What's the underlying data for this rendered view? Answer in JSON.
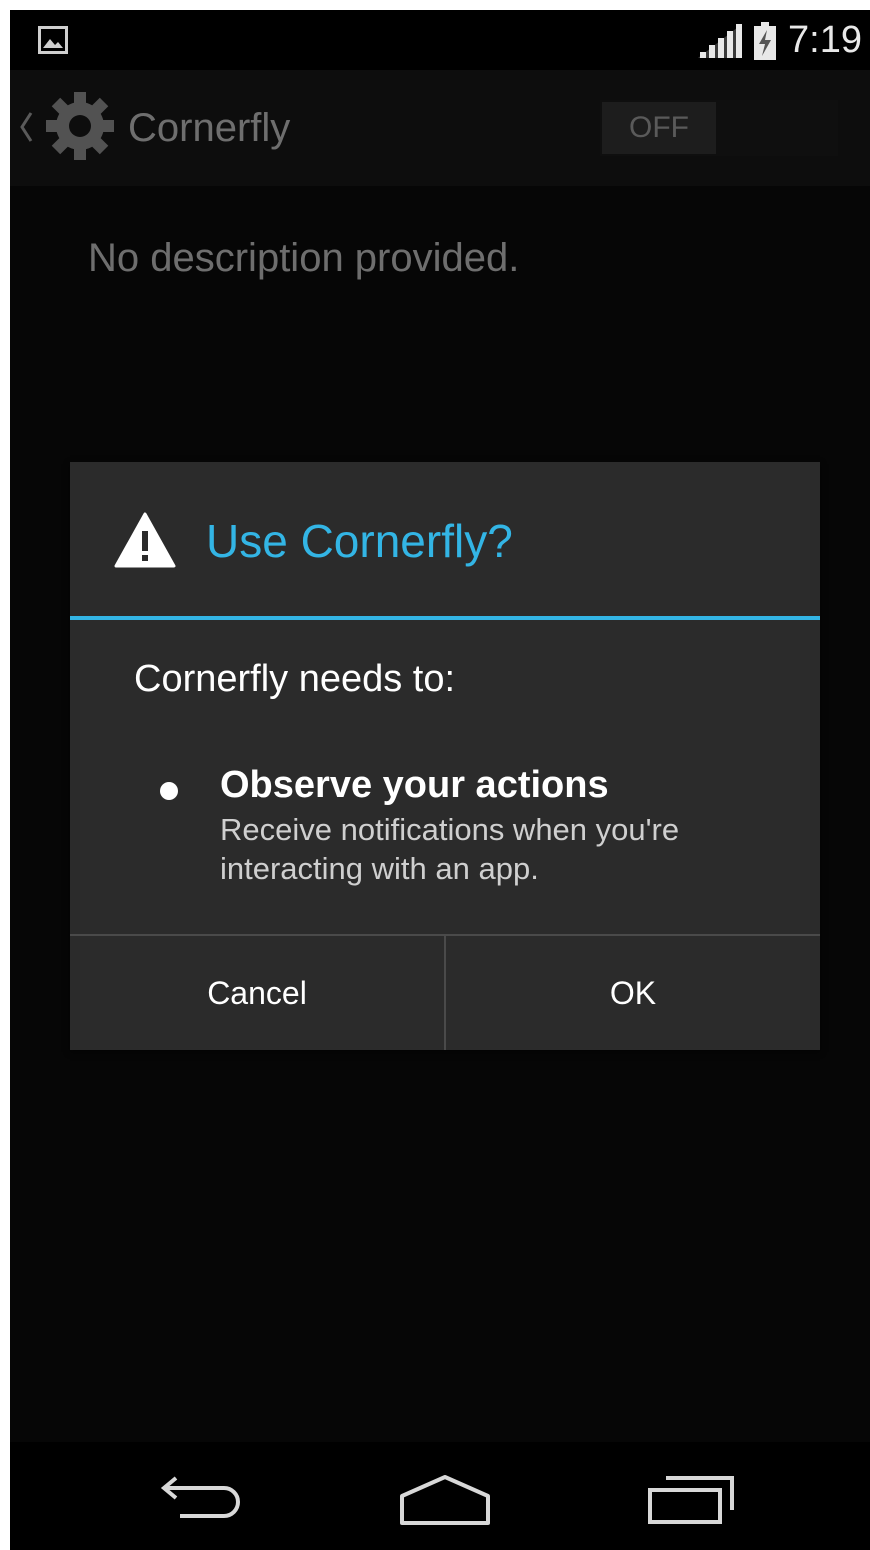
{
  "status_bar": {
    "time": "7:19",
    "icons": [
      "image-notification-icon",
      "signal-icon",
      "battery-charging-icon"
    ]
  },
  "action_bar": {
    "title": "Cornerfly",
    "app_icon": "gear-icon",
    "toggle_label": "OFF",
    "toggle_on": false
  },
  "content": {
    "description": "No description provided."
  },
  "dialog": {
    "title": "Use Cornerfly?",
    "title_icon": "warning-icon",
    "intro": "Cornerfly needs to:",
    "permissions": [
      {
        "title": "Observe your actions",
        "description": "Receive notifications when you're interacting with an app."
      }
    ],
    "buttons": {
      "cancel": "Cancel",
      "ok": "OK"
    }
  },
  "nav_bar": {
    "icons": [
      "back-icon",
      "home-icon",
      "recents-icon"
    ]
  },
  "colors": {
    "accent": "#33b5e5",
    "dialog_bg": "#2b2b2b",
    "screen_bg": "#060606"
  }
}
